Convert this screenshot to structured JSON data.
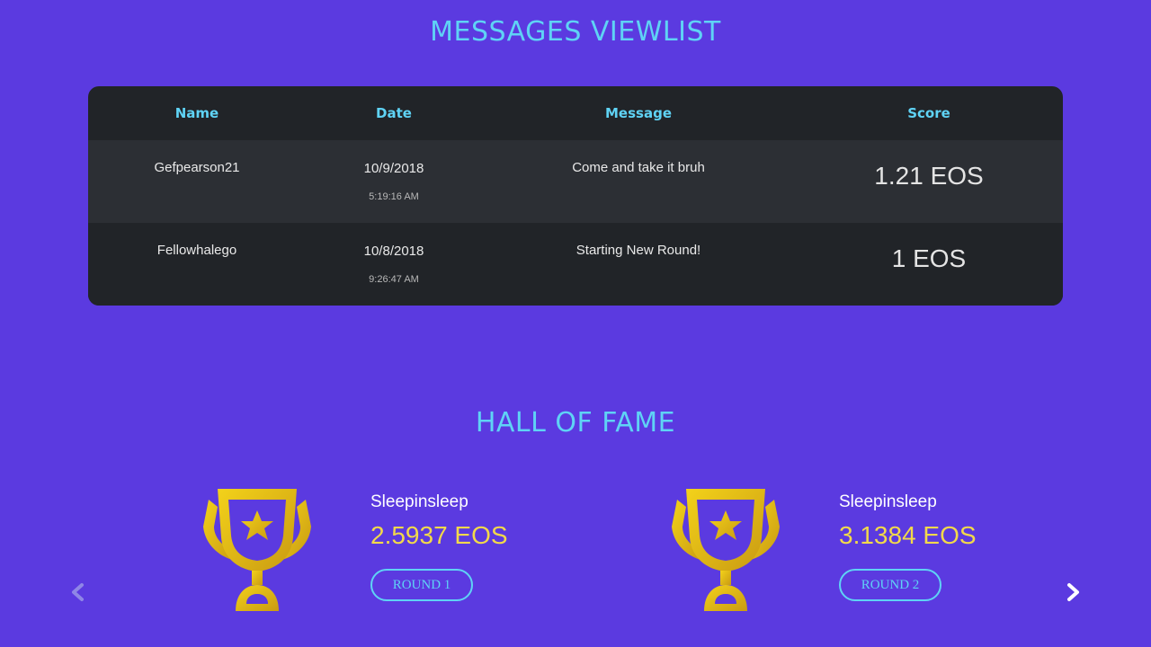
{
  "messages": {
    "title": "MESSAGES VIEWLIST",
    "columns": [
      "Name",
      "Date",
      "Message",
      "Score"
    ],
    "rows": [
      {
        "name": "Gefpearson21",
        "date": "10/9/2018",
        "time": "5:19:16 AM",
        "message": "Come and take it bruh",
        "score": "1.21 EOS"
      },
      {
        "name": "Fellowhalego",
        "date": "10/8/2018",
        "time": "9:26:47 AM",
        "message": "Starting New Round!",
        "score": "1 EOS"
      }
    ]
  },
  "hall_of_fame": {
    "title": "HALL OF FAME",
    "entries": [
      {
        "name": "Sleepinsleep",
        "amount": "2.5937 EOS",
        "round_label": "ROUND 1",
        "icon": "trophy-icon"
      },
      {
        "name": "Sleepinsleep",
        "amount": "3.1384 EOS",
        "round_label": "ROUND 2",
        "icon": "trophy-icon"
      }
    ],
    "prev_icon": "chevron-left-icon",
    "next_icon": "chevron-right-icon"
  },
  "colors": {
    "background": "#5b3ae0",
    "accent": "#5fd3f5",
    "gold": "#f2d94a",
    "table_bg": "#212428",
    "table_row_alt": "#2c2f34"
  }
}
